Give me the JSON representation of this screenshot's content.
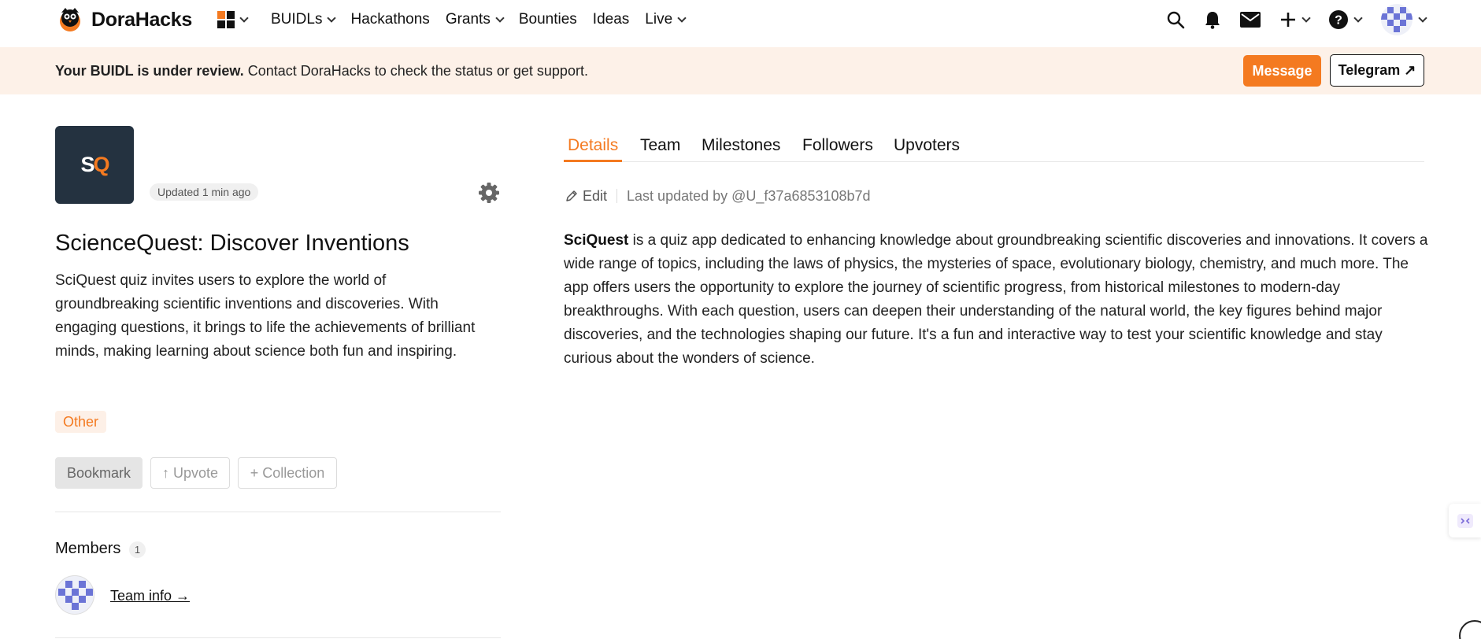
{
  "brand": {
    "name": "DoraHacks",
    "accent": "#f47a20"
  },
  "nav": {
    "items": [
      {
        "label": "BUIDLs",
        "dropdown": true
      },
      {
        "label": "Hackathons",
        "dropdown": false
      },
      {
        "label": "Grants",
        "dropdown": true
      },
      {
        "label": "Bounties",
        "dropdown": false
      },
      {
        "label": "Ideas",
        "dropdown": false
      },
      {
        "label": "Live",
        "dropdown": true
      }
    ],
    "right_icons": [
      "search-icon",
      "bell-icon",
      "mail-icon",
      "plus-icon",
      "help-icon",
      "avatar"
    ]
  },
  "banner": {
    "bold": "Your BUIDL is under review.",
    "text": " Contact DoraHacks to check the status or get support.",
    "message_label": "Message",
    "telegram_label": "Telegram ↗"
  },
  "project": {
    "logo_letters": {
      "s": "S",
      "q": "Q"
    },
    "updated": "Updated 1 min ago",
    "title": "ScienceQuest: Discover Inventions",
    "description": "SciQuest quiz invites users to explore the world of groundbreaking scientific inventions and discoveries. With engaging questions, it brings to life the achievements of brilliant minds, making learning about science both fun and inspiring.",
    "tag": "Other",
    "actions": {
      "bookmark": "Bookmark",
      "upvote": "↑ Upvote",
      "collection": "+ Collection"
    }
  },
  "members": {
    "title": "Members",
    "count": "1",
    "team_link": "Team info →"
  },
  "tabs": [
    "Details",
    "Team",
    "Milestones",
    "Followers",
    "Upvoters"
  ],
  "details": {
    "edit_label": "Edit",
    "last_updated": "Last updated by @U_f37a6853108b7d",
    "body_bold": "SciQuest",
    "body_text": " is a quiz app dedicated to enhancing knowledge about groundbreaking scientific discoveries and innovations. It covers a wide range of topics, including the laws of physics, the mysteries of space, evolutionary biology, chemistry, and much more. The app offers users the opportunity to explore the journey of scientific progress, from historical milestones to modern-day breakthroughs. With each question, users can deepen their understanding of the natural world, the key figures behind major discoveries, and the technologies shaping our future. It's a fun and interactive way to test your scientific knowledge and stay curious about the wonders of science."
  }
}
